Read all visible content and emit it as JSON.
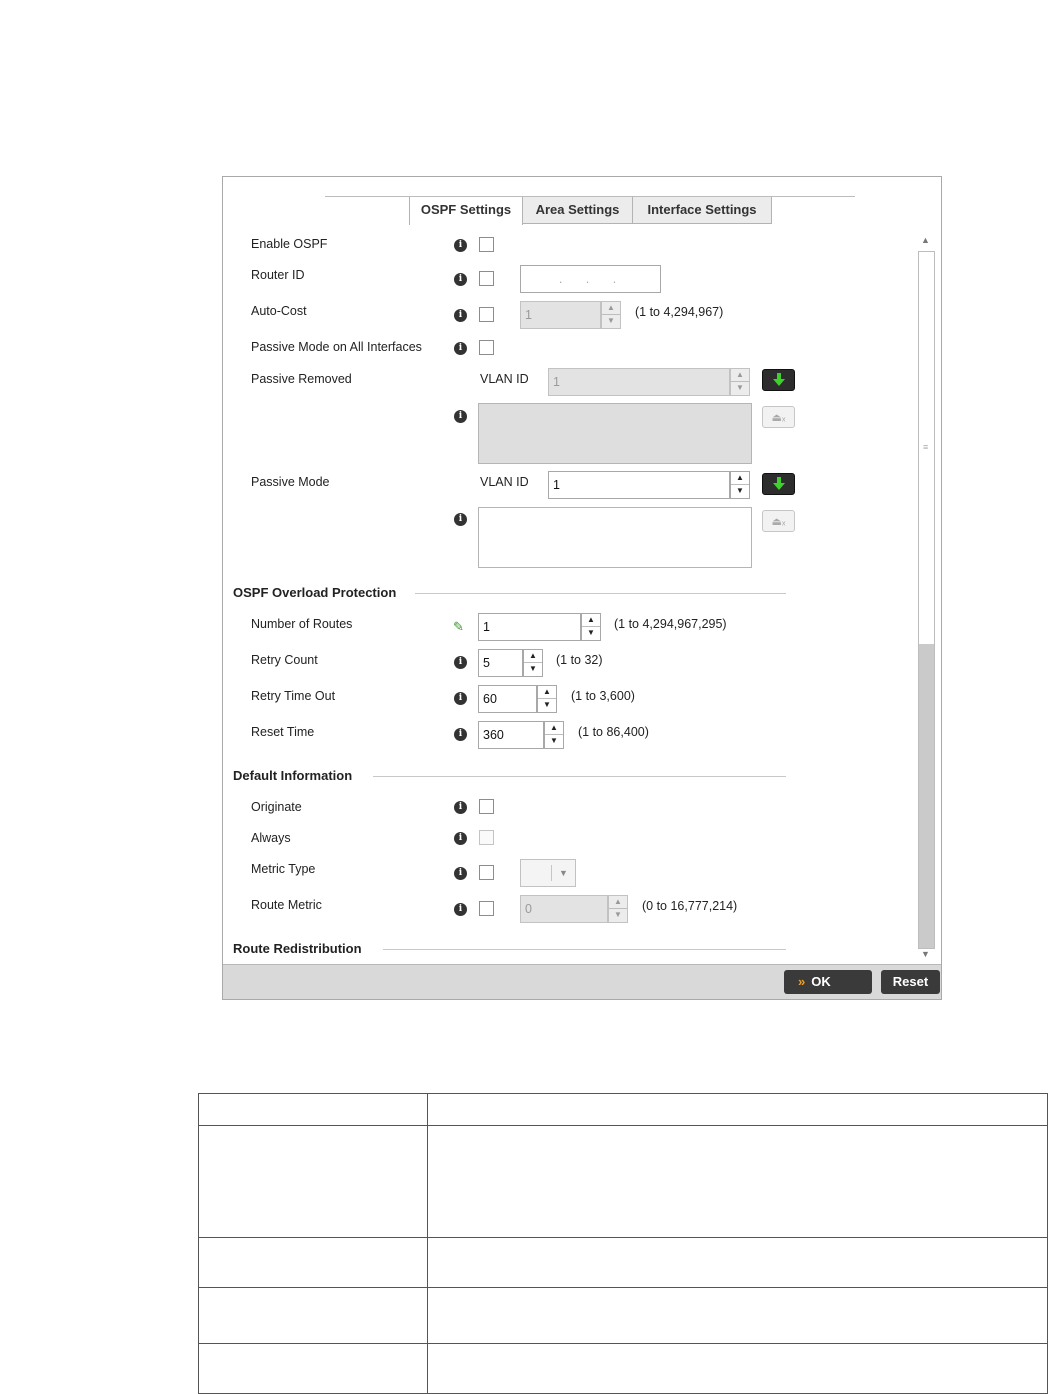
{
  "tabs": [
    "OSPF Settings",
    "Area Settings",
    "Interface Settings"
  ],
  "active_tab": "OSPF Settings",
  "settings": {
    "enable_ospf": "Enable OSPF",
    "router_id": "Router ID",
    "router_id_placeholder": ". . .",
    "auto_cost": "Auto-Cost",
    "auto_cost_value": "1",
    "auto_cost_range": "(1 to 4,294,967)",
    "passive_all": "Passive Mode on All Interfaces",
    "passive_removed": "Passive Removed",
    "passive_removed_vlan_label": "VLAN ID",
    "passive_removed_vlan_value": "1",
    "passive_mode": "Passive Mode",
    "passive_mode_vlan_label": "VLAN ID",
    "passive_mode_vlan_value": "1"
  },
  "overload": {
    "title": "OSPF Overload Protection",
    "num_routes_label": "Number of Routes",
    "num_routes_value": "1",
    "num_routes_range": "(1 to 4,294,967,295)",
    "retry_count_label": "Retry Count",
    "retry_count_value": "5",
    "retry_count_range": "(1 to 32)",
    "retry_timeout_label": "Retry Time Out",
    "retry_timeout_value": "60",
    "retry_timeout_range": "(1 to 3,600)",
    "reset_time_label": "Reset Time",
    "reset_time_value": "360",
    "reset_time_range": "(1 to 86,400)"
  },
  "default_info": {
    "title": "Default Information",
    "originate": "Originate",
    "always": "Always",
    "metric_type": "Metric Type",
    "route_metric": "Route Metric",
    "route_metric_value": "0",
    "route_metric_range": "(0 to 16,777,214)"
  },
  "route_redistribution": {
    "title": "Route Redistribution"
  },
  "footer": {
    "ok": "OK",
    "reset": "Reset"
  },
  "icons": {
    "info": "info-icon",
    "pencil": "pencil-icon",
    "add": "add-arrow-icon",
    "remove": "remove-icon"
  },
  "colors": {
    "accent_green": "#3ed12e",
    "button_dark": "#3a3a3a",
    "ok_chevron": "#f0a020"
  }
}
